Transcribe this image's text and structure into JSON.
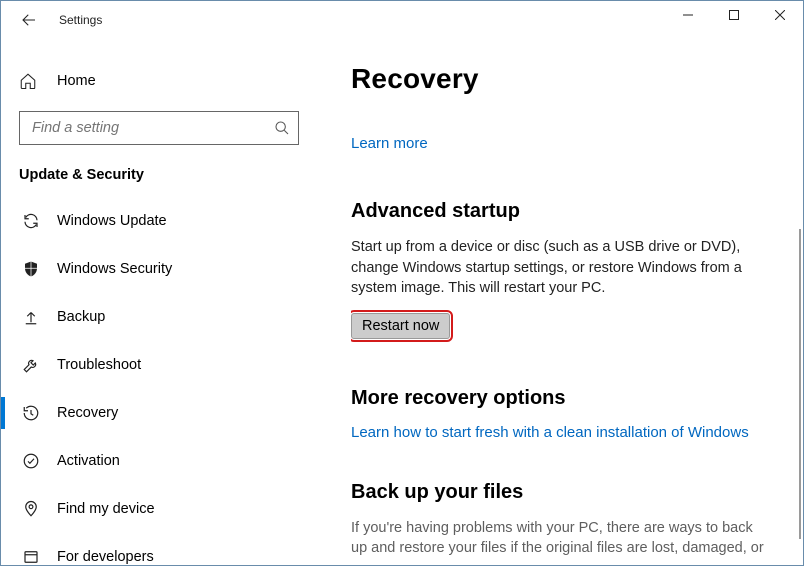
{
  "window": {
    "title": "Settings"
  },
  "home": {
    "label": "Home"
  },
  "search": {
    "placeholder": "Find a setting"
  },
  "category": "Update & Security",
  "nav": [
    {
      "id": "windows-update",
      "label": "Windows Update"
    },
    {
      "id": "windows-security",
      "label": "Windows Security"
    },
    {
      "id": "backup",
      "label": "Backup"
    },
    {
      "id": "troubleshoot",
      "label": "Troubleshoot"
    },
    {
      "id": "recovery",
      "label": "Recovery",
      "selected": true
    },
    {
      "id": "activation",
      "label": "Activation"
    },
    {
      "id": "find-my-device",
      "label": "Find my device"
    },
    {
      "id": "for-developers",
      "label": "For developers"
    }
  ],
  "page": {
    "title": "Recovery",
    "learn_more": "Learn more",
    "advanced": {
      "heading": "Advanced startup",
      "body": "Start up from a device or disc (such as a USB drive or DVD), change Windows startup settings, or restore Windows from a system image. This will restart your PC.",
      "button": "Restart now"
    },
    "more": {
      "heading": "More recovery options",
      "link": "Learn how to start fresh with a clean installation of Windows"
    },
    "backup": {
      "heading": "Back up your files",
      "body": "If you're having problems with your PC, there are ways to back up and restore your files if the original files are lost, damaged, or"
    }
  }
}
